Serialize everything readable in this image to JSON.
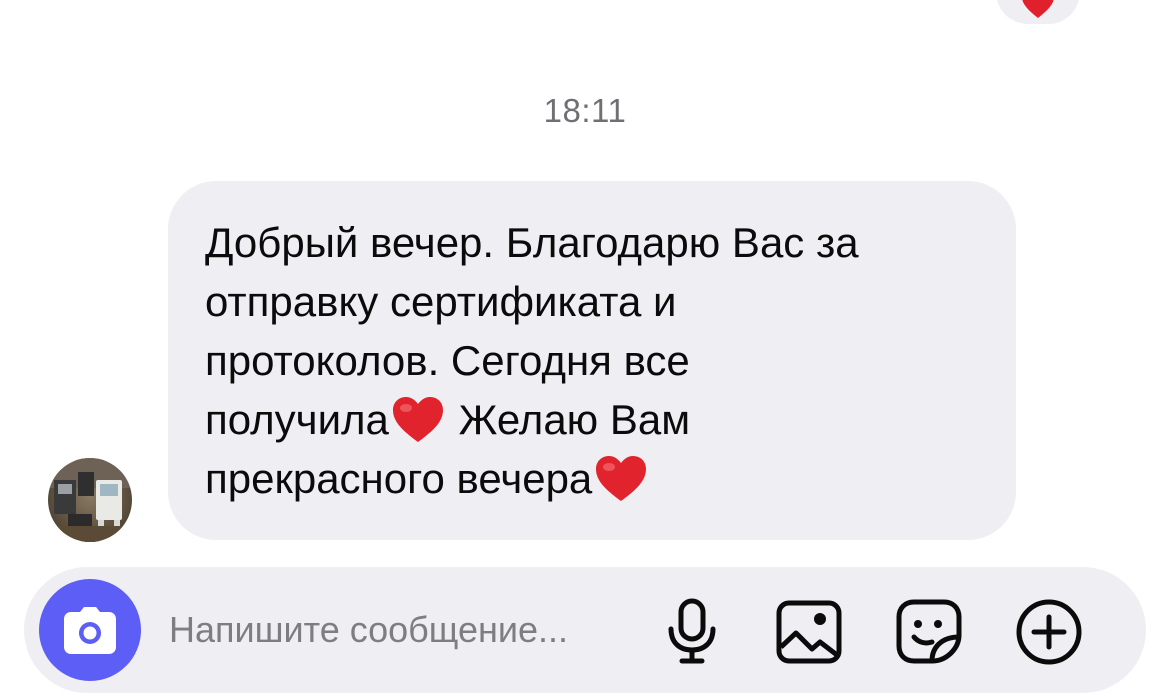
{
  "top_reaction": {
    "emoji": "red-heart",
    "color": "#e0202a"
  },
  "timestamp": "18:11",
  "message": {
    "sender_avatar": "avatar-photo",
    "lines": [
      "Добрый вечер. Благодарю Вас за",
      "отправку сертификата и",
      "протоколов. Сегодня все",
      "получила",
      " Желаю Вам",
      "прекрасного вечера"
    ],
    "bubble_color": "#efeff3"
  },
  "composer": {
    "placeholder": "Напишите сообщение...",
    "value": "",
    "camera_icon": "camera-icon",
    "accent_color": "#5c5ef5",
    "actions": {
      "mic": "microphone-icon",
      "gallery": "image-icon",
      "sticker": "sticker-icon",
      "more": "plus-icon"
    }
  }
}
